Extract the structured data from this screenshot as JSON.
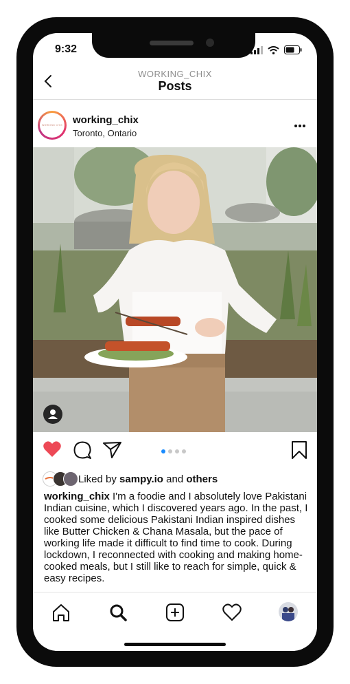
{
  "status_bar": {
    "time": "9:32"
  },
  "nav": {
    "account": "WORKING_CHIX",
    "title": "Posts"
  },
  "post": {
    "username": "working_chix",
    "location": "Toronto, Ontario",
    "avatar_text": "WORKING CHIX",
    "carousel": {
      "count": 4,
      "active": 1
    },
    "likes": {
      "prefix": "Liked by",
      "user": "sampy.io",
      "joiner": "and",
      "others": "others"
    },
    "caption": {
      "author": "working_chix",
      "text": "I'm a foodie and I absolutely love Pakistani Indian cuisine, which I discovered years ago. In the past, I cooked some delicious Pakistani Indian inspired dishes like Butter Chicken & Chana Masala, but the pace of working life made it difficult to find time to cook. During lockdown, I reconnected with cooking and making home-cooked meals, but I still like to reach for simple, quick & easy recipes."
    }
  },
  "colors": {
    "like": "#ed4956",
    "carousel_active": "#1a8cff",
    "text": "#111111"
  },
  "icons": [
    "back-icon",
    "more-icon",
    "heart-icon",
    "comment-icon",
    "share-icon",
    "bookmark-icon",
    "home-icon",
    "search-icon",
    "new-post-icon",
    "activity-icon",
    "profile-icon",
    "user-tag-icon"
  ]
}
